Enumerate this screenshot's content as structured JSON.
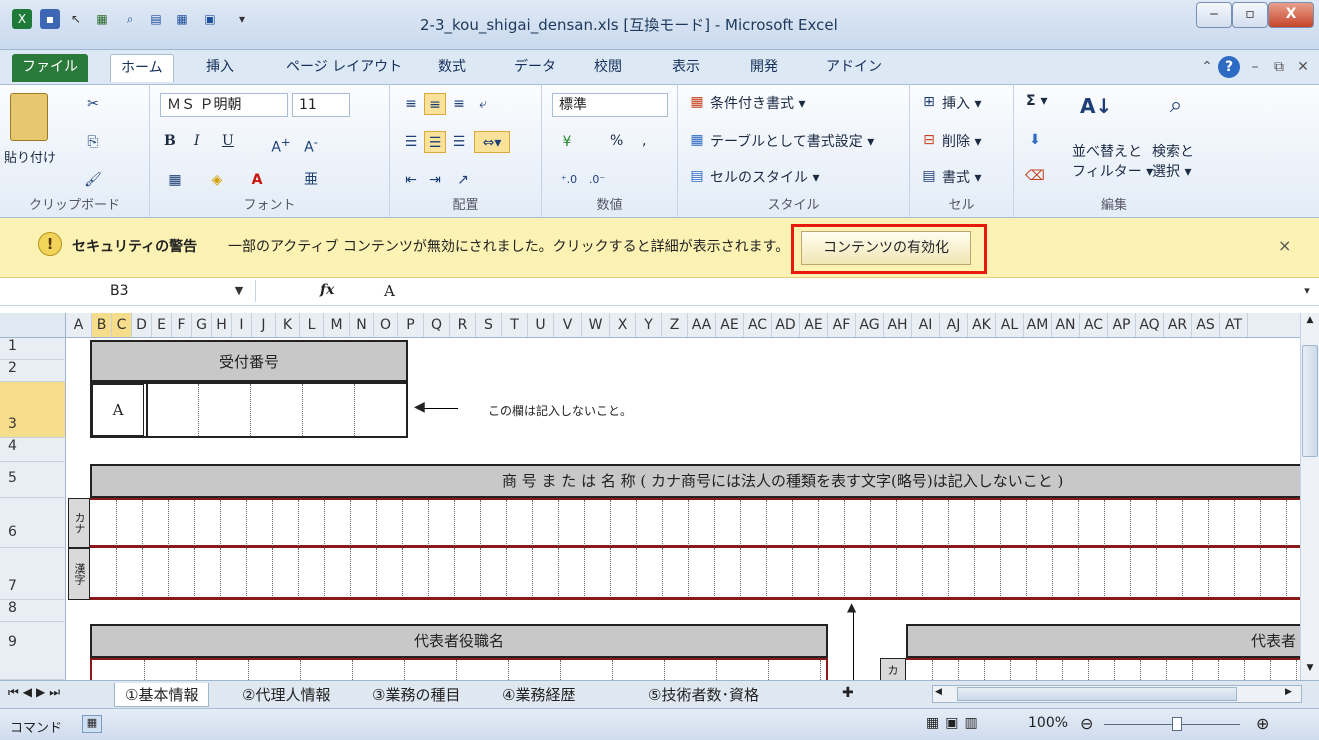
{
  "window": {
    "title": "2-3_kou_shigai_densan.xls [互換モード] - Microsoft Excel",
    "minimize": "‒",
    "maximize": "▫",
    "close": "X"
  },
  "menu": {
    "tabs": [
      "ファイル",
      "ホーム",
      "挿入",
      "ページ レイアウト",
      "数式",
      "データ",
      "校閲",
      "表示",
      "開発",
      "アドイン"
    ]
  },
  "ribbon": {
    "clipboard": {
      "paste": "貼り付け",
      "label": "クリップボード"
    },
    "font": {
      "name": "ＭＳ Ｐ明朝",
      "size": "11",
      "label": "フォント",
      "bold": "B",
      "italic": "I",
      "underline": "U"
    },
    "alignment": {
      "label": "配置"
    },
    "number": {
      "format": "標準",
      "label": "数値",
      "percent": "%",
      "comma": ","
    },
    "styles": {
      "conditional": "条件付き書式 ▾",
      "table": "テーブルとして書式設定 ▾",
      "cell_styles": "セルのスタイル ▾",
      "label": "スタイル"
    },
    "cells": {
      "insert": "挿入 ▾",
      "delete": "削除 ▾",
      "format": "書式 ▾",
      "label": "セル"
    },
    "editing": {
      "sum": "Σ ▾",
      "sort": "並べ替えと",
      "sort2": "フィルター ▾",
      "find": "検索と",
      "find2": "選択 ▾",
      "label": "編集"
    }
  },
  "security": {
    "title": "セキュリティの警告",
    "message": "一部のアクティブ コンテンツが無効にされました。クリックすると詳細が表示されます。",
    "enable_button": "コンテンツの有効化",
    "close": "×"
  },
  "formula_bar": {
    "name_box": "B3",
    "fx": "fx",
    "content": "A"
  },
  "columns": [
    "A",
    "B",
    "C",
    "D",
    "E",
    "F",
    "G",
    "H",
    "I",
    "J",
    "K",
    "L",
    "M",
    "N",
    "O",
    "P",
    "Q",
    "R",
    "S",
    "T",
    "U",
    "V",
    "W",
    "X",
    "Y",
    "Z",
    "AA",
    "AE",
    "AC",
    "AD",
    "AE",
    "AF",
    "AG",
    "AH",
    "AI",
    "AJ",
    "AK",
    "AL",
    "AM",
    "AN",
    "AC",
    "AP",
    "AQ",
    "AR",
    "AS",
    "AT"
  ],
  "rows": [
    "1",
    "2",
    "3",
    "4",
    "5",
    "6",
    "7",
    "8",
    "9"
  ],
  "sheet": {
    "receipt_header": "受付番号",
    "receipt_value": "A",
    "arrow_note": "この欄は記入しないこと。",
    "name_header": "商 号 ま た は 名 称 ( カナ商号には法人の種類を表す文字(略号)は記入しないこと )",
    "kana_label": "カナ",
    "kanji_label": "漢字",
    "rep_title_header": "代表者役職名",
    "rep_header": "代表者",
    "kana_label2": "カ"
  },
  "sheet_tabs": [
    "①基本情報",
    "②代理人情報",
    "③業務の種目",
    "④業務経歴",
    "⑤技術者数･資格"
  ],
  "status": {
    "mode": "コマンド",
    "zoom": "100%"
  }
}
